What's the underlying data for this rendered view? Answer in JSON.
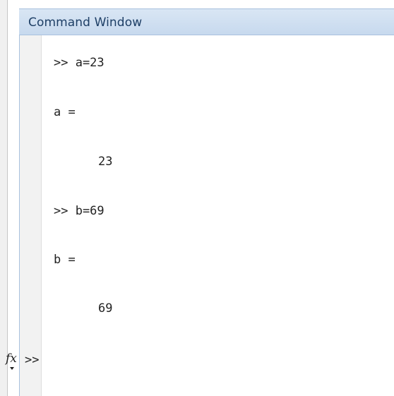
{
  "window": {
    "title": "Command Window"
  },
  "console": {
    "lines": [
      ">> a=23",
      "a =",
      "23",
      ">> b=69",
      "b =",
      "69"
    ],
    "prompt": ">>"
  },
  "icons": {
    "function_browser": "fx-icon"
  }
}
